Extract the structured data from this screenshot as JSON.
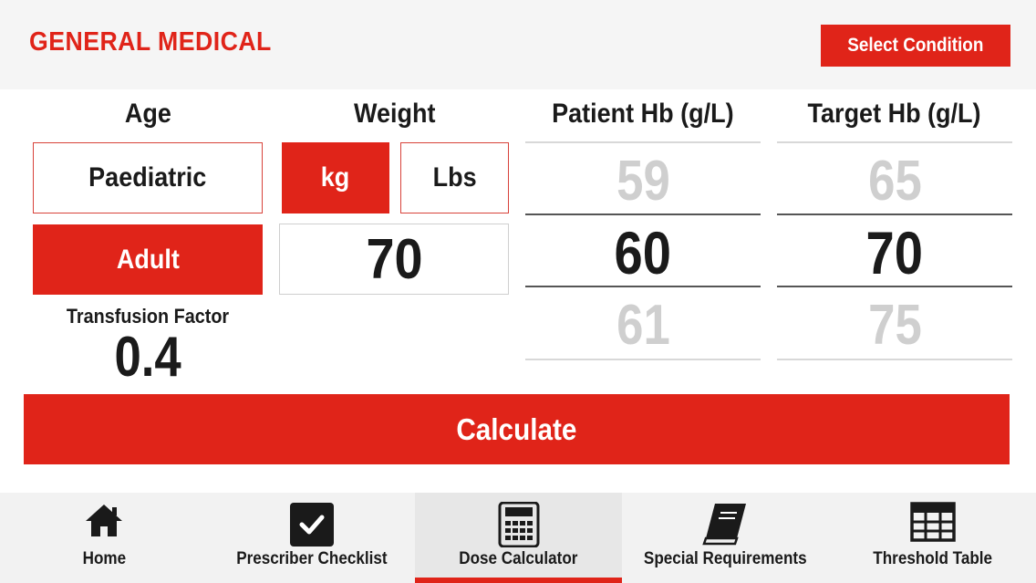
{
  "header": {
    "title": "GENERAL MEDICAL",
    "select_condition": "Select Condition"
  },
  "age": {
    "label": "Age",
    "options": [
      "Paediatric",
      "Adult"
    ],
    "selected": "Adult"
  },
  "weight": {
    "label": "Weight",
    "units": [
      "kg",
      "Lbs"
    ],
    "selected_unit": "kg",
    "value": "70"
  },
  "transfusion": {
    "label": "Transfusion Factor",
    "value": "0.4"
  },
  "patient_hb": {
    "label": "Patient Hb (g/L)",
    "above": "59",
    "current": "60",
    "below": "61"
  },
  "target_hb": {
    "label": "Target Hb (g/L)",
    "above": "65",
    "current": "70",
    "below": "75"
  },
  "calculate_label": "Calculate",
  "nav": {
    "items": [
      {
        "label": "Home",
        "icon": "home-icon"
      },
      {
        "label": "Prescriber Checklist",
        "icon": "checkbox-icon"
      },
      {
        "label": "Dose Calculator",
        "icon": "calculator-icon"
      },
      {
        "label": "Special Requirements",
        "icon": "book-icon"
      },
      {
        "label": "Threshold Table",
        "icon": "table-icon"
      }
    ],
    "active": "Dose Calculator"
  },
  "colors": {
    "accent": "#e02419",
    "faded_text": "#cfcfcf",
    "nav_background": "#f2f2f2"
  }
}
